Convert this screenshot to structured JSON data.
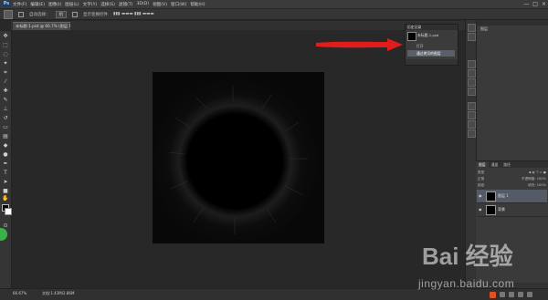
{
  "app": {
    "logo": "Ps"
  },
  "menubar": {
    "items": [
      "文件(F)",
      "编辑(E)",
      "图像(I)",
      "图层(L)",
      "文字(Y)",
      "选择(S)",
      "滤镜(T)",
      "3D(D)",
      "视图(V)",
      "窗口(W)",
      "帮助(H)"
    ],
    "window_controls": [
      "—",
      "□",
      "×"
    ]
  },
  "options_bar": {
    "auto_select_label": "自动选择：",
    "auto_select_value": "组",
    "show_transform_label": "显示变换控件"
  },
  "document": {
    "tab_label": "未标题-1.psd @ 66.7% (图层 1, RGB/8)"
  },
  "history_panel": {
    "title": "历史记录",
    "snapshot_label": "未标题-1.psd",
    "rows": [
      "打开",
      "通过拷贝的图层"
    ],
    "selected_index": 1
  },
  "right_panel": {
    "top_label": "图层"
  },
  "layers_panel": {
    "tabs": [
      "图层",
      "通道",
      "路径"
    ],
    "kind_label": "类型",
    "blend_mode": "正常",
    "opacity_label": "不透明度: 100%",
    "lock_label": "锁定:",
    "fill_label": "填充: 100%",
    "layers": [
      {
        "name": "图层 1",
        "selected": true
      },
      {
        "name": "背景",
        "selected": false
      }
    ]
  },
  "status_bar": {
    "zoom": "66.67%",
    "doc_size": "文档:1.43M/2.86M"
  },
  "watermark": {
    "brand": "Bai 经验",
    "url": "jingyan.baidu.com"
  },
  "colors": {
    "annotation_arrow": "#e21b1b",
    "selected_row": "#5a5f6a",
    "ps_logo": "#1b3f62"
  },
  "icons": {
    "tools": [
      "move-tool-icon",
      "marquee-tool-icon",
      "lasso-tool-icon",
      "magic-wand-tool-icon",
      "crop-tool-icon",
      "eyedropper-tool-icon",
      "healing-brush-tool-icon",
      "brush-tool-icon",
      "clone-stamp-tool-icon",
      "history-brush-tool-icon",
      "eraser-tool-icon",
      "gradient-tool-icon",
      "blur-tool-icon",
      "dodge-tool-icon",
      "pen-tool-icon",
      "type-tool-icon",
      "path-selection-tool-icon",
      "shape-tool-icon",
      "hand-tool-icon",
      "zoom-tool-icon"
    ]
  }
}
